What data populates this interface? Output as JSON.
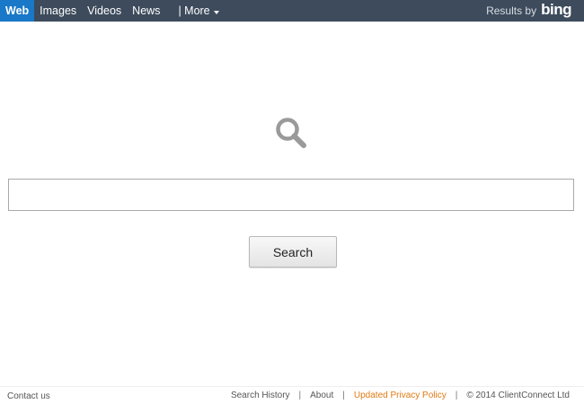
{
  "nav": {
    "tabs": [
      {
        "label": "Web",
        "active": true
      },
      {
        "label": "Images"
      },
      {
        "label": "Videos"
      },
      {
        "label": "News"
      }
    ],
    "more_label": "| More"
  },
  "branding": {
    "results_by": "Results by",
    "logo_text": "bing"
  },
  "search": {
    "icon": "magnifier-icon",
    "input_value": "",
    "button_label": "Search"
  },
  "footer": {
    "contact": "Contact us",
    "links": {
      "history": "Search History",
      "about": "About",
      "privacy": "Updated Privacy Policy",
      "copyright": "© 2014 ClientConnect Ltd"
    },
    "separator": "|"
  },
  "colors": {
    "topbar": "#3d4b5c",
    "active_tab": "#1a78c8",
    "privacy_link": "#e07a12"
  }
}
